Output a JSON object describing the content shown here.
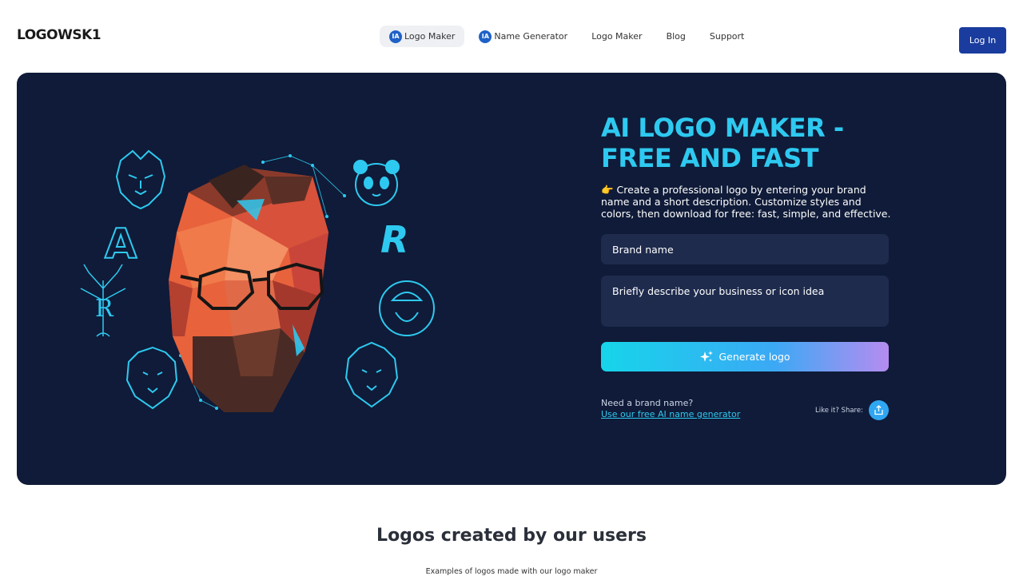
{
  "header": {
    "logo": "LOGOWSK1",
    "nav": [
      {
        "badge": "IA",
        "label": "Logo Maker"
      },
      {
        "badge": "IA",
        "label": "Name Generator"
      },
      {
        "label": "Logo Maker"
      },
      {
        "label": "Blog"
      },
      {
        "label": "Support"
      }
    ],
    "login_label": "Log In"
  },
  "hero": {
    "headline": "AI LOGO MAKER - FREE AND FAST",
    "description": "👉 Create a professional logo by entering your brand name and a short description. Customize styles and colors, then download for free: fast, simple, and effective.",
    "brand_placeholder": "Brand name",
    "describe_placeholder": "Briefly describe your business or icon idea",
    "generate_label": "Generate logo",
    "need_text": "Need a brand name?",
    "name_link": "Use our free AI name generator",
    "like_text": "Like it? Share:",
    "art_letters": [
      "A",
      "R",
      "R"
    ]
  },
  "section": {
    "title": "Logos created by our users",
    "subtitle": "Examples of logos made with our logo maker"
  },
  "colors": {
    "hero_bg": "#0f1b38",
    "accent": "#2ec9f0",
    "login_bg": "#1a3c9e",
    "field_bg": "#1e2b4d"
  }
}
